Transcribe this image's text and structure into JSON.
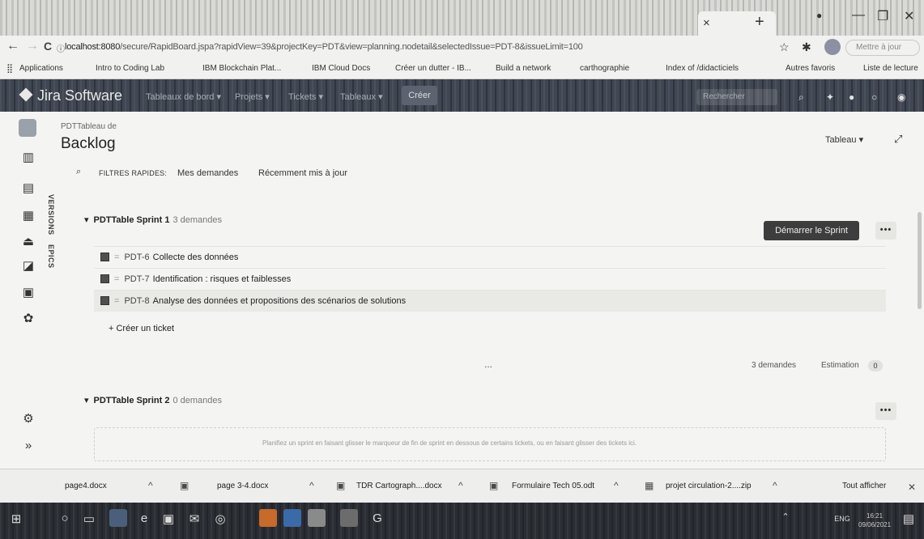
{
  "browser": {
    "url_host": "localhost:8080",
    "url_path": "/secure/RapidBoard.jspa?rapidView=39&projectKey=PDT&view=planning.nodetail&selectedIssue=PDT-8&issueLimit=100",
    "profile_pill": "Mettre à jour",
    "close_tab": "×",
    "new_tab": "+",
    "bookmarks": [
      "Applications",
      "Intro to Coding Lab",
      "IBM Blockchain Plat...",
      "IBM Cloud Docs",
      "Créer un dutter - IB...",
      "Build a network",
      "carthographie",
      "Index of /didacticiels",
      "Autres favoris",
      "Liste de lecture"
    ]
  },
  "jira": {
    "logo": "Jira Software",
    "menu": [
      "Tableaux de bord ▾",
      "Projets ▾",
      "Tickets ▾",
      "Tableaux ▾"
    ],
    "create_label": "Créer",
    "search_placeholder": "Rechercher"
  },
  "board": {
    "breadcrumb": "PDTTableau de",
    "title": "Backlog",
    "view_select": "Tableau ▾",
    "side_tabs": [
      "VERSIONS",
      "EPICS"
    ],
    "filters": {
      "label": "FILTRES RAPIDES:",
      "items": [
        "Mes demandes",
        "Récemment mis à jour"
      ]
    }
  },
  "sprints": [
    {
      "name": "PDTTable Sprint 1",
      "count": "3 demandes",
      "start_label": "Démarrer le Sprint",
      "more_label": "•••",
      "issues": [
        {
          "key": "PDT-6",
          "summary": "Collecte des données"
        },
        {
          "key": "PDT-7",
          "summary": "Identification : risques et faiblesses"
        },
        {
          "key": "PDT-8",
          "summary": "Analyse des données et propositions des scénarios de solutions"
        }
      ],
      "create_label": "+ Créer un ticket",
      "ellipsis": "...",
      "footer_count": "3 demandes",
      "estimation_label": "Estimation",
      "estimation_value": "0"
    },
    {
      "name": "PDTTable Sprint 2",
      "count": "0 demandes",
      "more_label": "•••",
      "empty_text": "Planifiez un sprint en faisant glisser le marqueur de fin de sprint en dessous de certains tickets, ou en faisant glisser des tickets ici."
    }
  ],
  "downloads": {
    "files": [
      "page4.docx",
      "page 3-4.docx",
      "TDR Cartograph....docx",
      "Formulaire Tech 05.odt",
      "projet circulation-2....zip"
    ],
    "show_all": "Tout afficher"
  },
  "taskbar": {
    "time": "16:21",
    "date": "09/06/2021",
    "lang": "ENG"
  }
}
